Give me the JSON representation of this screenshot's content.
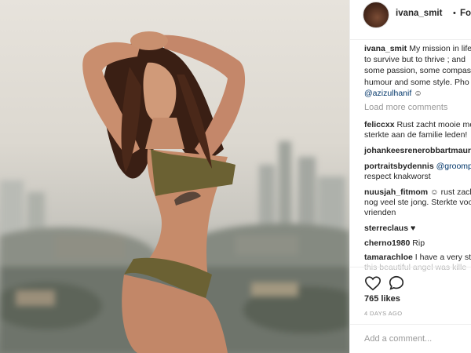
{
  "header": {
    "username": "ivana_smit",
    "separator": "•",
    "follow_label": "Followi"
  },
  "caption": {
    "username": "ivana_smit",
    "line1": "My mission in life",
    "line2": "to survive but to thrive ; and",
    "line3": "some passion, some compass",
    "line4": "humour and some style. Pho",
    "mention": "@azizulhanif"
  },
  "load_more": "Load more comments",
  "comments": [
    {
      "user": "feliccxx",
      "line1": "Rust zacht mooie me",
      "line2": "sterkte aan de familie leden!"
    },
    {
      "user": "johankeesrenerobbartmauri",
      "line1": "",
      "line2": ""
    },
    {
      "user": "portraitsbydennis",
      "mention": "@groomp",
      "line2": "respect knakworst"
    },
    {
      "user": "nuusjah_fitmom",
      "line1": "rust zach",
      "line2": "nog veel ste jong. Sterkte voo",
      "line3": "vrienden"
    },
    {
      "user": "sterreclaus",
      "line1": "♥"
    },
    {
      "user": "cherno1980",
      "line1": "Rip"
    },
    {
      "user": "tamarachloe",
      "line1": "I have a very st",
      "line2": "this beautiful angel was kille"
    }
  ],
  "likes": "765 likes",
  "date": "4 DAYS AGO",
  "add_comment_placeholder": "Add a comment...",
  "icons": [
    "heart-icon",
    "comment-icon"
  ]
}
